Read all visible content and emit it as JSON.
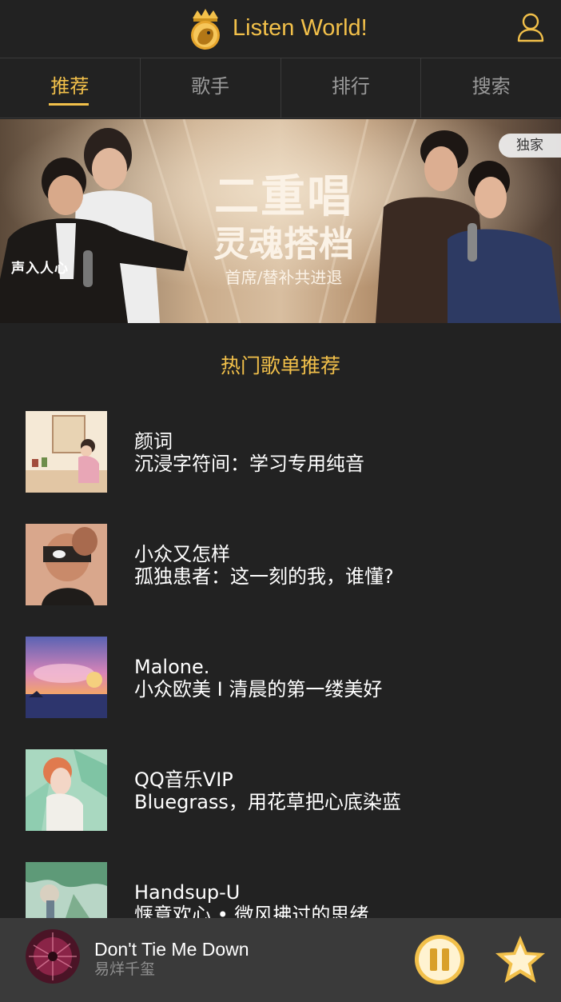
{
  "header": {
    "title": "Listen World!",
    "logo_icon": "crowned-lion-logo",
    "user_icon": "user-icon",
    "accent_color": "#f2c04a"
  },
  "tabs": [
    {
      "label": "推荐",
      "active": true
    },
    {
      "label": "歌手",
      "active": false
    },
    {
      "label": "排行",
      "active": false
    },
    {
      "label": "搜索",
      "active": false
    }
  ],
  "banner": {
    "badge": "独家",
    "title_line1": "二重唱",
    "title_line2": "灵魂搭档",
    "subtitle": "首席/替补共进退",
    "show_logo": "声入人心"
  },
  "section": {
    "title": "热门歌单推荐"
  },
  "playlists": [
    {
      "name": "颜词",
      "desc": "沉浸字符间：学习专用纯音"
    },
    {
      "name": "小众又怎样",
      "desc": "孤独患者：这一刻的我，谁懂?"
    },
    {
      "name": "Malone.",
      "desc": "小众欧美 I 清晨的第一缕美好"
    },
    {
      "name": "QQ音乐VIP",
      "desc": "Bluegrass，用花草把心底染蓝"
    },
    {
      "name": "Handsup-U",
      "desc": "惬意欢心 • 微风拂过的思绪"
    }
  ],
  "player": {
    "song": "Don't Tie Me Down",
    "artist": "易烊千玺",
    "pause_icon": "pause-icon",
    "favorite_icon": "star-icon"
  }
}
